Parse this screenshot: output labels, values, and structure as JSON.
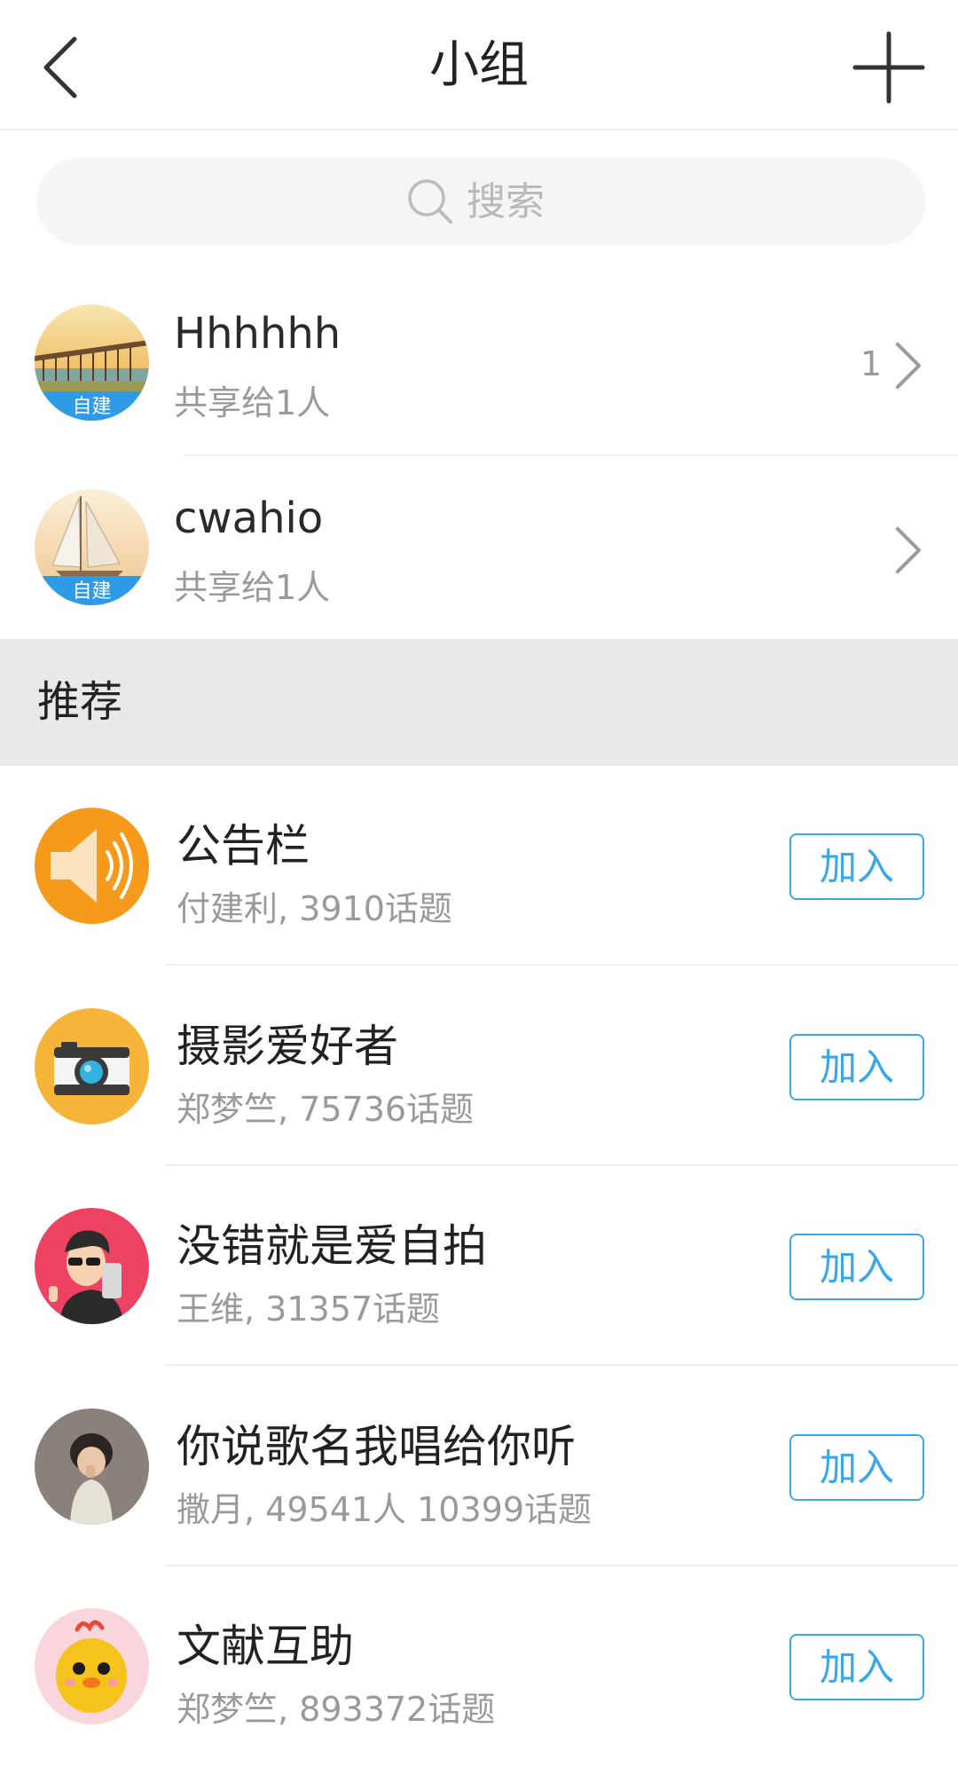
{
  "header": {
    "title": "小组",
    "back_icon": "chevron-left-icon",
    "add_icon": "plus-icon"
  },
  "search": {
    "placeholder": "搜索",
    "icon": "search-icon"
  },
  "own_groups": [
    {
      "name": "Hhhhhh",
      "subtitle": "共享给1人",
      "badge": "自建",
      "count": "1"
    },
    {
      "name": "cwahio",
      "subtitle": "共享给1人",
      "badge": "自建",
      "count": ""
    }
  ],
  "section": {
    "label": "推荐"
  },
  "recommended": [
    {
      "name": "公告栏",
      "subtitle": "付建利, 3910话题",
      "button": "加入",
      "avatar": "speaker-icon"
    },
    {
      "name": "摄影爱好者",
      "subtitle": "郑梦竺, 75736话题",
      "button": "加入",
      "avatar": "camera-icon"
    },
    {
      "name": "没错就是爱自拍",
      "subtitle": "王维, 31357话题",
      "button": "加入",
      "avatar": "selfie-avatar"
    },
    {
      "name": "你说歌名我唱给你听",
      "subtitle": "撒月, 49541人 10399话题",
      "button": "加入",
      "avatar": "child-photo-avatar"
    },
    {
      "name": "文献互助",
      "subtitle": "郑梦竺, 893372话题",
      "button": "加入",
      "avatar": "chick-avatar"
    }
  ],
  "colors": {
    "accent": "#3aa8e8",
    "badge_blue": "#2f9ae6",
    "section_bg": "#e9e9eb",
    "speaker_orange": "#f69a1c",
    "camera_yellow": "#f6b53a",
    "selfie_red": "#ee4262"
  }
}
